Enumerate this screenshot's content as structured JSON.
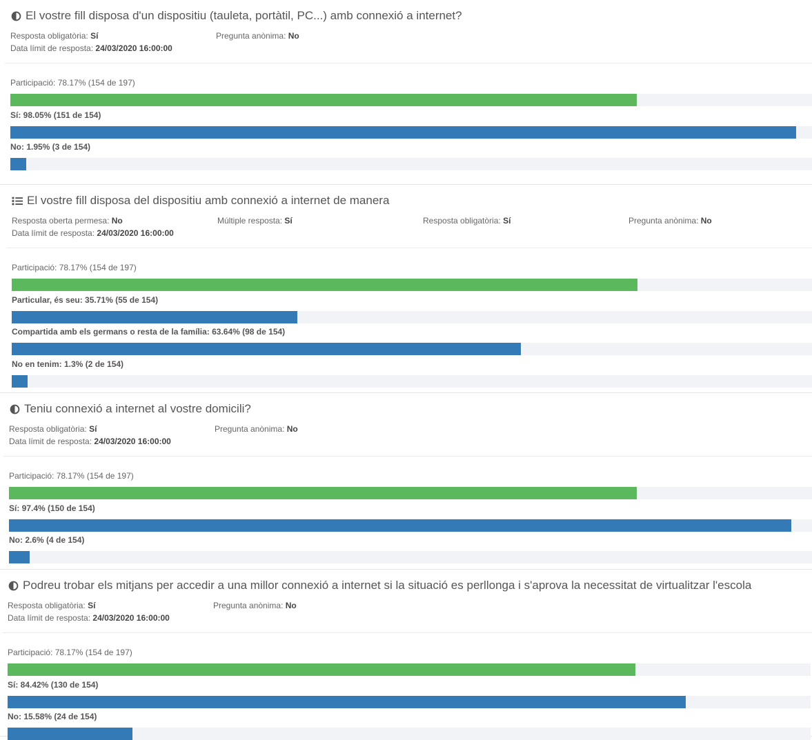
{
  "colors": {
    "participation": "#5cb85c",
    "answer": "#337ab7",
    "track": "#f2f3f7"
  },
  "questions": [
    {
      "icon": "half-circle-icon",
      "title": "El vostre fill disposa d'un dispositiu (tauleta, portàtil, PC...) amb connexió a internet?",
      "meta": [
        {
          "label": "Resposta obligatòria:",
          "value": "Sí"
        },
        {
          "label": "Pregunta anònima:",
          "value": "No"
        }
      ],
      "deadline": {
        "label": "Data límit de resposta:",
        "value": "24/03/2020 16:00:00"
      },
      "participation": {
        "text": "Participació: 78.17% (154 de 197)",
        "pct": 78.17
      },
      "answers": [
        {
          "text": "Sí: 98.05% (151 de 154)",
          "pct": 98.05
        },
        {
          "text": "No: 1.95% (3 de 154)",
          "pct": 1.95
        }
      ]
    },
    {
      "icon": "list-icon",
      "title": "El vostre fill disposa del dispositiu amb connexió a internet de manera",
      "meta": [
        {
          "label": "Resposta oberta permesa:",
          "value": "No"
        },
        {
          "label": "Múltiple resposta:",
          "value": "Sí"
        },
        {
          "label": "Resposta obligatòria:",
          "value": "Sí"
        },
        {
          "label": "Pregunta anònima:",
          "value": "No"
        }
      ],
      "deadline": {
        "label": "Data límit de resposta:",
        "value": "24/03/2020 16:00:00"
      },
      "participation": {
        "text": "Participació: 78.17% (154 de 197)",
        "pct": 78.17
      },
      "answers": [
        {
          "text": "Particular, és seu: 35.71% (55 de 154)",
          "pct": 35.71
        },
        {
          "text": "Compartida amb els germans o resta de la família: 63.64% (98 de 154)",
          "pct": 63.64
        },
        {
          "text": "No en tenim: 1.3% (2 de 154)",
          "pct": 1.3
        }
      ]
    },
    {
      "icon": "half-circle-icon",
      "title": "Teniu connexió a internet al vostre domicili?",
      "meta": [
        {
          "label": "Resposta obligatòria:",
          "value": "Sí"
        },
        {
          "label": "Pregunta anònima:",
          "value": "No"
        }
      ],
      "deadline": {
        "label": "Data límit de resposta:",
        "value": "24/03/2020 16:00:00"
      },
      "participation": {
        "text": "Participació: 78.17% (154 de 197)",
        "pct": 78.17
      },
      "answers": [
        {
          "text": "Sí: 97.4% (150 de 154)",
          "pct": 97.4
        },
        {
          "text": "No: 2.6% (4 de 154)",
          "pct": 2.6
        }
      ]
    },
    {
      "icon": "half-circle-icon",
      "title": "Podreu trobar els mitjans per accedir a una millor connexió a internet si la situació es perllonga i s'aprova la necessitat de virtualitzar l'escola",
      "meta": [
        {
          "label": "Resposta obligatòria:",
          "value": "Sí"
        },
        {
          "label": "Pregunta anònima:",
          "value": "No"
        }
      ],
      "deadline": {
        "label": "Data límit de resposta:",
        "value": "24/03/2020 16:00:00"
      },
      "participation": {
        "text": "Participació: 78.17% (154 de 197)",
        "pct": 78.17
      },
      "answers": [
        {
          "text": "Sí: 84.42% (130 de 154)",
          "pct": 84.42
        },
        {
          "text": "No: 15.58% (24 de 154)",
          "pct": 15.58
        }
      ]
    }
  ]
}
